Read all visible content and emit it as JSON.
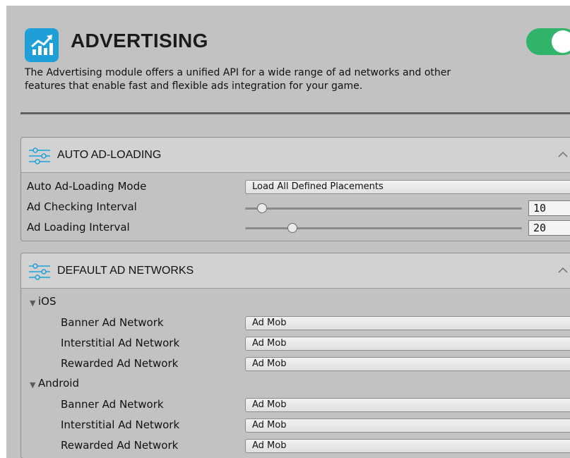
{
  "header": {
    "title": "ADVERTISING",
    "description": "The Advertising module offers a unified API for a wide range of ad networks and other\nfeatures that enable fast and flexible ads integration for your game.",
    "icon": "chart-icon",
    "module_enabled": true
  },
  "auto_ad_loading": {
    "title": "AUTO AD-LOADING",
    "icon": "sliders-icon",
    "mode_label": "Auto Ad-Loading Mode",
    "mode_value": "Load All Defined Placements",
    "checking_label": "Ad Checking Interval",
    "checking_value": "10",
    "checking_level": 0.06,
    "loading_label": "Ad Loading Interval",
    "loading_value": "20",
    "loading_level": 0.17
  },
  "default_ad_networks": {
    "title": "DEFAULT AD NETWORKS",
    "icon": "sliders-icon",
    "ios": {
      "label": "iOS",
      "rows": [
        {
          "label": "Banner Ad Network",
          "value": "Ad Mob"
        },
        {
          "label": "Interstitial Ad Network",
          "value": "Ad Mob"
        },
        {
          "label": "Rewarded Ad Network",
          "value": "Ad Mob"
        }
      ]
    },
    "android": {
      "label": "Android",
      "rows": [
        {
          "label": "Banner Ad Network",
          "value": "Ad Mob"
        },
        {
          "label": "Interstitial Ad Network",
          "value": "Ad Mob"
        },
        {
          "label": "Rewarded Ad Network",
          "value": "Ad Mob"
        }
      ]
    }
  },
  "colors": {
    "accent": "#1e9fd8",
    "toggle_on": "#2fb46a",
    "panel_bg": "#c2c2c2"
  }
}
